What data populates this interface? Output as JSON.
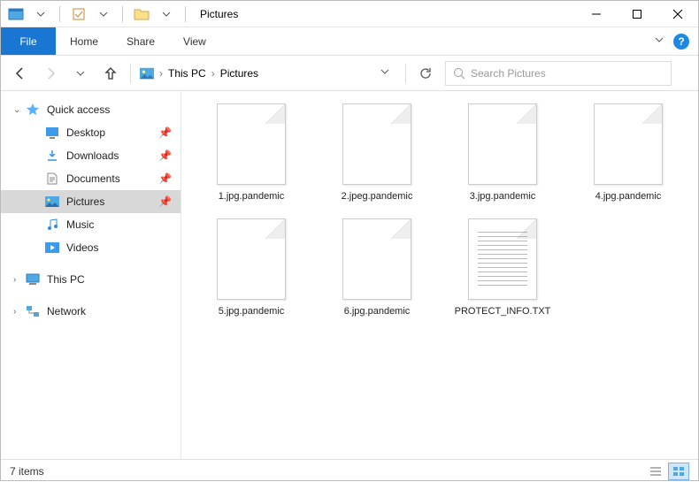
{
  "window": {
    "title": "Pictures"
  },
  "ribbon": {
    "file": "File",
    "tabs": [
      "Home",
      "Share",
      "View"
    ]
  },
  "breadcrumb": {
    "items": [
      "This PC",
      "Pictures"
    ]
  },
  "search": {
    "placeholder": "Search Pictures"
  },
  "sidebar": {
    "quickaccess": {
      "label": "Quick access"
    },
    "qa_items": [
      {
        "label": "Desktop",
        "icon": "desktop",
        "pinned": true
      },
      {
        "label": "Downloads",
        "icon": "downloads",
        "pinned": true
      },
      {
        "label": "Documents",
        "icon": "documents",
        "pinned": true
      },
      {
        "label": "Pictures",
        "icon": "pictures",
        "pinned": true,
        "selected": true
      },
      {
        "label": "Music",
        "icon": "music",
        "pinned": false
      },
      {
        "label": "Videos",
        "icon": "videos",
        "pinned": false
      }
    ],
    "thispc": {
      "label": "This PC"
    },
    "network": {
      "label": "Network"
    }
  },
  "files": [
    {
      "name": "1.jpg.pandemic",
      "type": "blank"
    },
    {
      "name": "2.jpeg.pandemic",
      "type": "blank"
    },
    {
      "name": "3.jpg.pandemic",
      "type": "blank"
    },
    {
      "name": "4.jpg.pandemic",
      "type": "blank"
    },
    {
      "name": "5.jpg.pandemic",
      "type": "blank"
    },
    {
      "name": "6.jpg.pandemic",
      "type": "blank"
    },
    {
      "name": "PROTECT_INFO.TXT",
      "type": "txt"
    }
  ],
  "status": {
    "item_count": "7 items"
  }
}
